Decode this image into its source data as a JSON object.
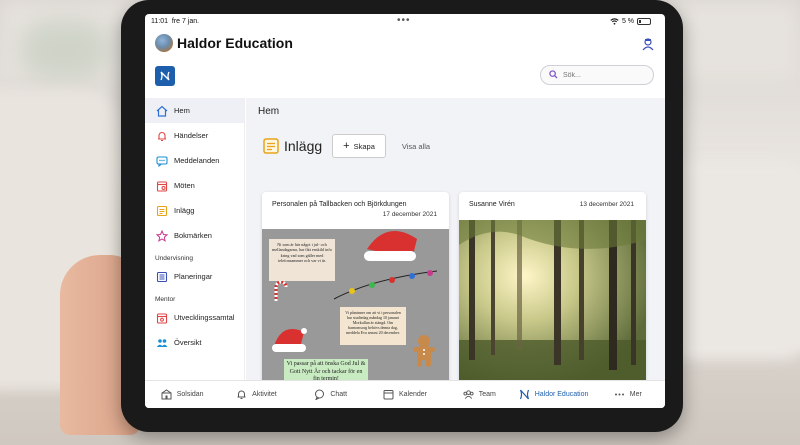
{
  "status_bar": {
    "time": "11:01",
    "date": "fre 7 jan.",
    "dots": "•••",
    "battery": "5 %"
  },
  "app": {
    "title": "Haldor Education"
  },
  "search": {
    "placeholder": "Sök..."
  },
  "sidebar": {
    "items": [
      {
        "label": "Hem",
        "icon": "home-icon",
        "color": "#2f6fd6"
      },
      {
        "label": "Händelser",
        "icon": "bell-icon",
        "color": "#e04545"
      },
      {
        "label": "Meddelanden",
        "icon": "chat-icon",
        "color": "#1a8fd6"
      },
      {
        "label": "Möten",
        "icon": "calendar-icon",
        "color": "#e04545"
      },
      {
        "label": "Inlägg",
        "icon": "news-icon",
        "color": "#e8a319"
      },
      {
        "label": "Bokmärken",
        "icon": "star-icon",
        "color": "#c73a8e"
      }
    ],
    "section_undervisning": "Undervisning",
    "undervisning_items": [
      {
        "label": "Planeringar",
        "icon": "planning-icon",
        "color": "#3b4fb8"
      }
    ],
    "section_mentor": "Mentor",
    "mentor_items": [
      {
        "label": "Utvecklingssamtal",
        "icon": "meeting-icon",
        "color": "#e04545"
      },
      {
        "label": "Översikt",
        "icon": "people-icon",
        "color": "#1a8fd6"
      }
    ]
  },
  "main": {
    "page_title": "Hem",
    "section_title": "Inlägg",
    "create_label": "Skapa",
    "view_all_label": "Visa alla",
    "cards": [
      {
        "title": "Personalen på Tallbacken och Björkdungen",
        "date": "17 december 2021",
        "note1": "Ni som är här något i jul- och mellandagarna, har fått enskild info kring vad som gäller med telefonsammer och var vi är.",
        "note2": "Vi påminner om att vi i personalen har studiedag måndag 10 januari Morkullan är stängd. Om barnomsorg behövs denna dag, meddela Eva senast 20 december.",
        "note3": "Vi passar på att önska God Jul & Gott Nytt År och tackar för en fin termin!"
      },
      {
        "title": "Susanne Virén",
        "date": "13 december 2021"
      }
    ]
  },
  "tabbar": [
    {
      "label": "Solsidan",
      "icon": "school-icon"
    },
    {
      "label": "Aktivitet",
      "icon": "bell-icon"
    },
    {
      "label": "Chatt",
      "icon": "chat-icon"
    },
    {
      "label": "Kalender",
      "icon": "calendar-icon"
    },
    {
      "label": "Team",
      "icon": "team-icon"
    },
    {
      "label": "Haldor Education",
      "icon": "haldor-logo-icon",
      "active": true
    },
    {
      "label": "Mer",
      "icon": "more-icon"
    }
  ],
  "colors": {
    "brand": "#1e5fad",
    "active_bg": "#eef0f5"
  }
}
